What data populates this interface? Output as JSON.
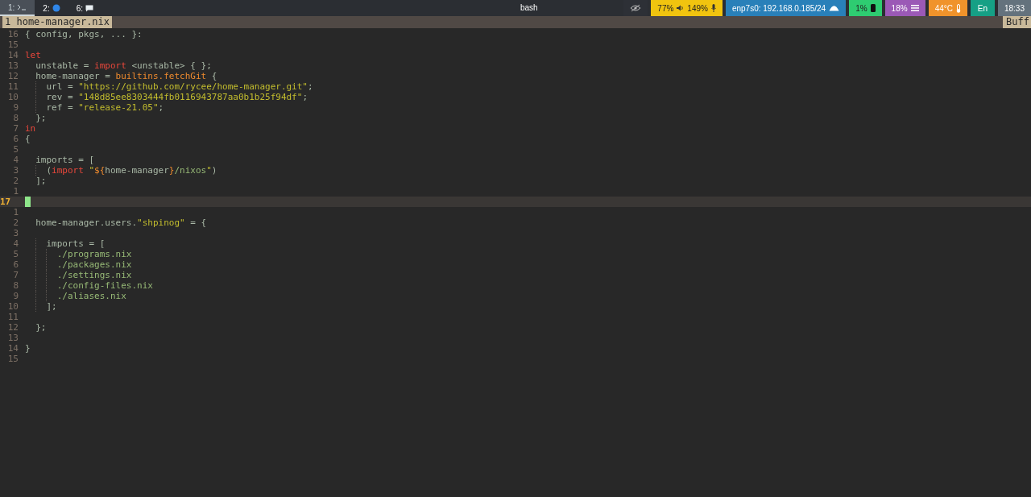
{
  "bar": {
    "workspaces": [
      {
        "label": "1:",
        "selected": true
      },
      {
        "label": "2:",
        "selected": false
      },
      {
        "label": "6:",
        "selected": false
      }
    ],
    "title": "bash",
    "modules": [
      {
        "color": "#2d3036",
        "parts": [
          {
            "kind": "icon"
          }
        ]
      },
      {
        "color": "#f1c40f",
        "parts": [
          {
            "kind": "text",
            "text": "77%"
          },
          {
            "kind": "icon"
          },
          {
            "kind": "text",
            "text": "149%"
          },
          {
            "kind": "icon"
          }
        ]
      },
      {
        "color": "#2980b9",
        "parts": [
          {
            "kind": "text",
            "text": "enp7s0: 192.168.0.185/24"
          },
          {
            "kind": "icon"
          }
        ]
      },
      {
        "color": "#2ecc71",
        "parts": [
          {
            "kind": "text",
            "text": "1%"
          },
          {
            "kind": "icon"
          }
        ]
      },
      {
        "color": "#9b59b6",
        "parts": [
          {
            "kind": "text",
            "text": "18%"
          },
          {
            "kind": "icon"
          }
        ]
      },
      {
        "color": "#f0932b",
        "parts": [
          {
            "kind": "text",
            "text": "44°C"
          },
          {
            "kind": "icon"
          }
        ]
      },
      {
        "color": "#16a085",
        "parts": [
          {
            "kind": "text",
            "text": "En"
          }
        ]
      },
      {
        "color": "#64727d",
        "parts": [
          {
            "kind": "text",
            "text": "18:33"
          }
        ]
      }
    ]
  },
  "tabline": {
    "tabs": [
      {
        "label": "1 home-manager.nix",
        "selected": true
      }
    ],
    "right_label": "Buff"
  },
  "editor": {
    "lines": [
      {
        "number": "16",
        "current": false,
        "tokens": [
          {
            "kind": "plain",
            "text": "{ config, pkgs, ... }:"
          }
        ]
      },
      {
        "number": "15",
        "current": false
      },
      {
        "number": "14",
        "current": false,
        "tokens": [
          {
            "kind": "keyword",
            "text": "let"
          }
        ]
      },
      {
        "number": "13",
        "current": false,
        "tokens": [
          {
            "kind": "pad"
          },
          {
            "kind": "plain",
            "text": "unstable = "
          },
          {
            "kind": "keyword",
            "text": "import"
          },
          {
            "kind": "plain",
            "text": " <unstable> { };"
          }
        ]
      },
      {
        "number": "12",
        "current": false,
        "tokens": [
          {
            "kind": "pad"
          },
          {
            "kind": "plain",
            "text": "home-manager = "
          },
          {
            "kind": "function",
            "text": "builtins.fetchGit"
          },
          {
            "kind": "plain",
            "text": " {"
          }
        ]
      },
      {
        "number": "11",
        "current": false,
        "tokens": [
          {
            "kind": "pad"
          },
          {
            "kind": "guide"
          },
          {
            "kind": "plain",
            "text": "url = "
          },
          {
            "kind": "string",
            "text": "\"https://github.com/rycee/home-manager.git\""
          },
          {
            "kind": "plain",
            "text": ";"
          }
        ]
      },
      {
        "number": "10",
        "current": false,
        "tokens": [
          {
            "kind": "pad"
          },
          {
            "kind": "guide"
          },
          {
            "kind": "plain",
            "text": "rev = "
          },
          {
            "kind": "string",
            "text": "\"148d85ee8303444fb0116943787aa0b1b25f94df\""
          },
          {
            "kind": "plain",
            "text": ";"
          }
        ]
      },
      {
        "number": "9",
        "current": false,
        "tokens": [
          {
            "kind": "pad"
          },
          {
            "kind": "guide"
          },
          {
            "kind": "plain",
            "text": "ref = "
          },
          {
            "kind": "string",
            "text": "\"release-21.05\""
          },
          {
            "kind": "plain",
            "text": ";"
          }
        ]
      },
      {
        "number": "8",
        "current": false,
        "tokens": [
          {
            "kind": "pad"
          },
          {
            "kind": "plain",
            "text": "};"
          }
        ]
      },
      {
        "number": "7",
        "current": false,
        "tokens": [
          {
            "kind": "keyword",
            "text": "in"
          }
        ]
      },
      {
        "number": "6",
        "current": false,
        "tokens": [
          {
            "kind": "plain",
            "text": "{"
          }
        ]
      },
      {
        "number": "5",
        "current": false
      },
      {
        "number": "4",
        "current": false,
        "tokens": [
          {
            "kind": "pad"
          },
          {
            "kind": "plain",
            "text": "imports = ["
          }
        ]
      },
      {
        "number": "3",
        "current": false,
        "tokens": [
          {
            "kind": "pad"
          },
          {
            "kind": "guide"
          },
          {
            "kind": "plain",
            "text": "("
          },
          {
            "kind": "keyword",
            "text": "import"
          },
          {
            "kind": "string",
            "text": " \""
          },
          {
            "kind": "function",
            "text": "${"
          },
          {
            "kind": "plain",
            "text": "home-manager"
          },
          {
            "kind": "function",
            "text": "}"
          },
          {
            "kind": "path",
            "text": "/nixos"
          },
          {
            "kind": "string",
            "text": "\""
          },
          {
            "kind": "plain",
            "text": ")"
          }
        ]
      },
      {
        "number": "2",
        "current": false,
        "tokens": [
          {
            "kind": "pad"
          },
          {
            "kind": "plain",
            "text": "];"
          }
        ]
      },
      {
        "number": "1",
        "current": false
      },
      {
        "number": "17",
        "current": true
      },
      {
        "number": "1",
        "current": false
      },
      {
        "number": "2",
        "current": false,
        "tokens": [
          {
            "kind": "pad"
          },
          {
            "kind": "plain",
            "text": "home-manager.users."
          },
          {
            "kind": "string",
            "text": "\"shpinog\""
          },
          {
            "kind": "plain",
            "text": " = {"
          }
        ]
      },
      {
        "number": "3",
        "current": false
      },
      {
        "number": "4",
        "current": false,
        "tokens": [
          {
            "kind": "pad"
          },
          {
            "kind": "guide"
          },
          {
            "kind": "plain",
            "text": "imports = ["
          }
        ]
      },
      {
        "number": "5",
        "current": false,
        "tokens": [
          {
            "kind": "pad"
          },
          {
            "kind": "guide"
          },
          {
            "kind": "guide"
          },
          {
            "kind": "path",
            "text": "./programs.nix"
          }
        ]
      },
      {
        "number": "6",
        "current": false,
        "tokens": [
          {
            "kind": "pad"
          },
          {
            "kind": "guide"
          },
          {
            "kind": "guide"
          },
          {
            "kind": "path",
            "text": "./packages.nix"
          }
        ]
      },
      {
        "number": "7",
        "current": false,
        "tokens": [
          {
            "kind": "pad"
          },
          {
            "kind": "guide"
          },
          {
            "kind": "guide"
          },
          {
            "kind": "path",
            "text": "./settings.nix"
          }
        ]
      },
      {
        "number": "8",
        "current": false,
        "tokens": [
          {
            "kind": "pad"
          },
          {
            "kind": "guide"
          },
          {
            "kind": "guide"
          },
          {
            "kind": "path",
            "text": "./config-files.nix"
          }
        ]
      },
      {
        "number": "9",
        "current": false,
        "tokens": [
          {
            "kind": "pad"
          },
          {
            "kind": "guide"
          },
          {
            "kind": "guide"
          },
          {
            "kind": "path",
            "text": "./aliases.nix"
          }
        ]
      },
      {
        "number": "10",
        "current": false,
        "tokens": [
          {
            "kind": "pad"
          },
          {
            "kind": "guide"
          },
          {
            "kind": "plain",
            "text": "];"
          }
        ]
      },
      {
        "number": "11",
        "current": false
      },
      {
        "number": "12",
        "current": false,
        "tokens": [
          {
            "kind": "pad"
          },
          {
            "kind": "plain",
            "text": "};"
          }
        ]
      },
      {
        "number": "13",
        "current": false
      },
      {
        "number": "14",
        "current": false,
        "tokens": [
          {
            "kind": "plain",
            "text": "}"
          }
        ]
      },
      {
        "number": "15",
        "current": false
      }
    ]
  }
}
